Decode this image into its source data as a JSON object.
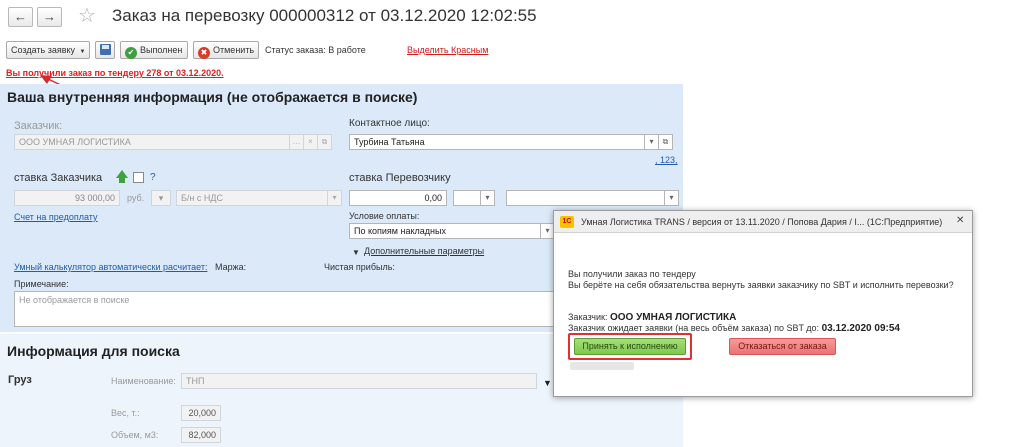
{
  "header": {
    "back_icon": "←",
    "forward_icon": "→",
    "star_icon": "☆",
    "title": "Заказ на перевозку 000000312 от 03.12.2020 12:02:55"
  },
  "toolbar": {
    "create_label": "Создать заявку",
    "save_icon": "floppy-icon",
    "done_label": "Выполнен",
    "cancel_label": "Отменить",
    "status_text": "Статус заказа: В работе",
    "highlight_link": "Выделить Красным"
  },
  "alert_text": "Вы получили заказ по тендеру 278 от 03.12.2020.",
  "internal": {
    "title": "Ваша внутренняя информация (не отображается в поиске)",
    "customer_label": "Заказчик:",
    "customer_value": "ООО УМНАЯ ЛОГИСТИКА",
    "contact_label": "Контактное лицо:",
    "contact_value": "Турбина Татьяна",
    "contact_extra": ", 123,",
    "customer_rate_label": "ставка Заказчика",
    "question_mark": "?",
    "customer_rate_value": "93 000,00",
    "currency": "руб.",
    "vat": "Б/н с НДС",
    "carrier_rate_label": "ставка Перевозчику",
    "carrier_rate_value": "0,00",
    "payment_condition_label": "Условие оплаты:",
    "payment_condition_value": "По копиям накладных",
    "prepayment_link": "Счет на предоплату",
    "extra_params_link": "Дополнительные параметры",
    "calculator_link": "Умный калькулятор автоматически расчитает:",
    "margin_label": "Маржа:",
    "net_profit_label": "Чистая прибыль:",
    "note_label": "Примечание:",
    "note_placeholder": "Не отображается в поиске"
  },
  "search_info": {
    "title": "Информация для поиска",
    "cargo_label": "Груз",
    "name_label": "Наименование:",
    "name_value": "ТНП",
    "weight_label": "Вес, т.:",
    "weight_value": "20,000",
    "volume_label": "Объем, м3:",
    "volume_value": "82,000"
  },
  "dialog": {
    "logo": "1С",
    "title": "Умная Логистика TRANS / версия от 13.11.2020 / Попова Дария / I... (1С:Предприятие)",
    "close_icon": "✕",
    "line1": "Вы получили заказ по тендеру",
    "line2": "Вы берёте на себя обязательства вернуть заявки заказчику по SBT и исполнить перевозки?",
    "customer_prefix": "Заказчик: ",
    "customer_name": "ООО УМНАЯ ЛОГИСТИКА",
    "deadline_prefix": "Заказчик ожидает заявки (на весь объём заказа) по SBT до: ",
    "deadline_value": "03.12.2020 09:54",
    "accept_label": "Принять к исполнению",
    "decline_label": "Отказаться от заказа"
  },
  "colors": {
    "panel_blue": "#dbe9f8",
    "alert_red": "#e01e1e",
    "accept_green": "#8fd35f",
    "decline_red": "#f07d7d",
    "link_blue": "#1d5cb0"
  }
}
